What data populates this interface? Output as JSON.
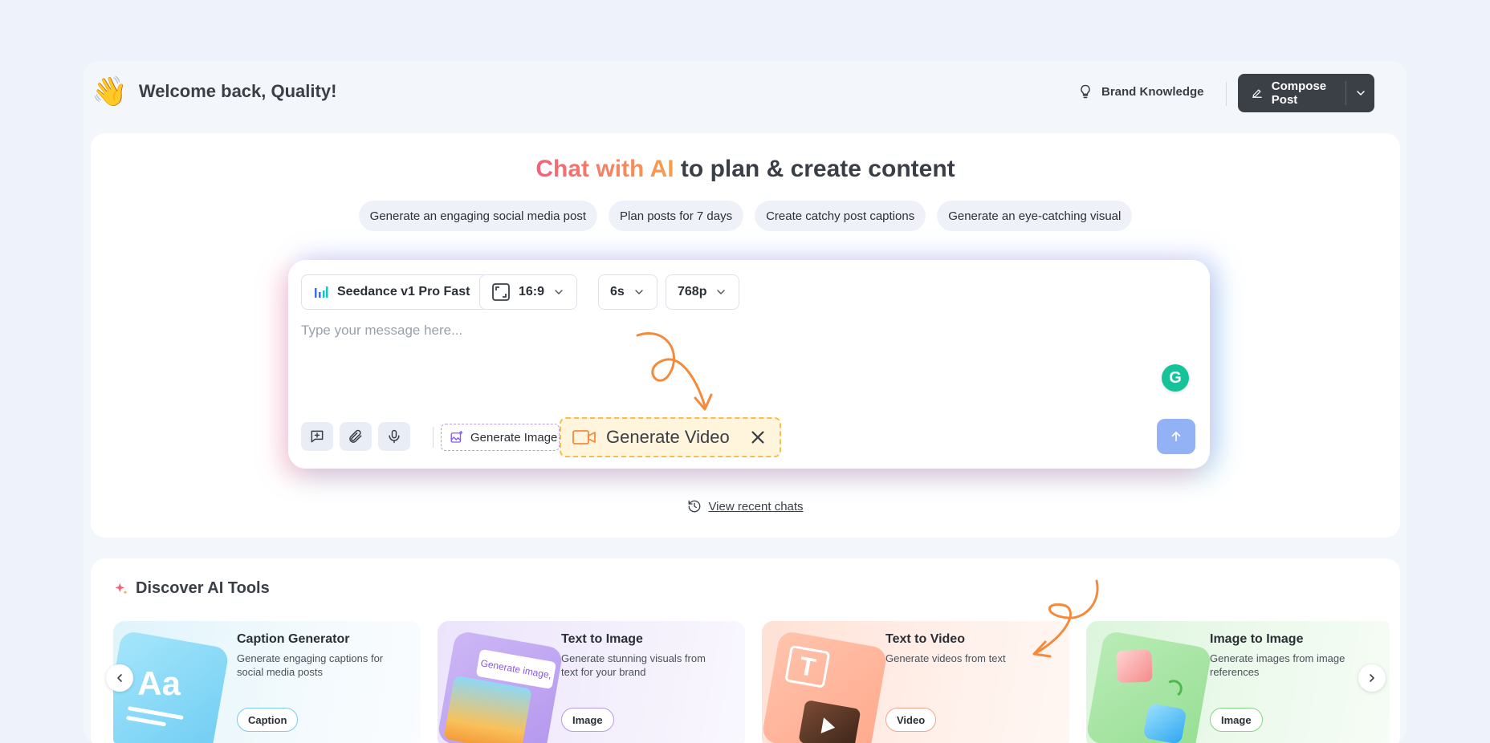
{
  "header": {
    "welcome_emoji": "👋",
    "welcome_text": "Welcome back, Quality!",
    "brand_knowledge": "Brand Knowledge",
    "compose_label": "Compose Post"
  },
  "hero": {
    "title_accent": "Chat with AI",
    "title_rest": " to plan & create content"
  },
  "suggestions": [
    "Generate an engaging social media post",
    "Plan posts for 7 days",
    "Create catchy post captions",
    "Generate an eye-catching visual"
  ],
  "composer": {
    "model": "Seedance v1 Pro Fast",
    "aspect_ratio": "16:9",
    "duration": "6s",
    "resolution": "768p",
    "placeholder": "Type your message here...",
    "grammarly_letter": "G",
    "generate_image": "Generate Image",
    "generate_video": "Generate Video"
  },
  "recent": {
    "label": "View recent chats"
  },
  "discover": {
    "title": "Discover AI Tools",
    "tools": [
      {
        "title": "Caption Generator",
        "desc": "Generate engaging captions for social media posts",
        "tag": "Caption",
        "art_text": "Aa"
      },
      {
        "title": "Text to Image",
        "desc": "Generate stunning visuals from text for your brand",
        "tag": "Image",
        "art_text": "Generate image,"
      },
      {
        "title": "Text to Video",
        "desc": "Generate videos from text",
        "tag": "Video",
        "art_text": "T"
      },
      {
        "title": "Image to Image",
        "desc": "Generate images from image references",
        "tag": "Image"
      }
    ]
  },
  "colors": {
    "accent_start": "#f4607a",
    "accent_end": "#f7a14b",
    "compose_bg": "#3b4046",
    "send_bg": "#93b2f5",
    "video_chip_bg": "#fff4dc",
    "doodle": "#f58a3d"
  }
}
